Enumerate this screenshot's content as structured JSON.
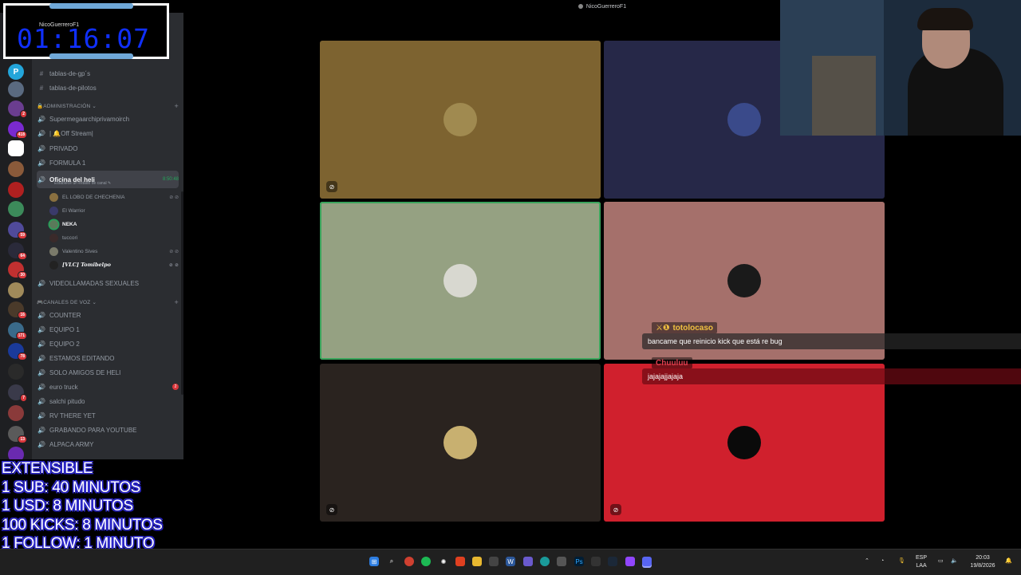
{
  "window_title": "NicoGuerreroF1",
  "timer": {
    "value": "01:16:07",
    "username": "NicoGuerreroF1"
  },
  "extensible": [
    "EXTENSIBLE",
    "1 SUB: 40 MINUTOS",
    "1 USD: 8 MINUTOS",
    "100 KICKS: 8 MINUTOS",
    "1 FOLLOW: 1 MINUTO"
  ],
  "channels_top": [
    {
      "name": "tablas-de-gp´s",
      "icon": "#"
    },
    {
      "name": "tablas-de-pilotos",
      "icon": "#"
    }
  ],
  "cat_admin": "🔒ADMINISTRACIÓN ⌄",
  "admin_channels": [
    {
      "name": "Supermegaarchiprivamoirch",
      "icon": "🔊"
    },
    {
      "name": "| 🔔Off Stream|",
      "icon": "🔊"
    },
    {
      "name": "PRIVADO",
      "icon": "🔊"
    },
    {
      "name": "FORMULA 1",
      "icon": "🔊"
    }
  ],
  "active_channel": {
    "name": "Oficina del heli",
    "time": "8:50:48",
    "status": "Establece un estado de canal ✎"
  },
  "members": [
    {
      "name": "EL LOBO DE CHECHENIA",
      "status": "⊘ ⊘",
      "style": ""
    },
    {
      "name": "El Warrior",
      "status": "",
      "style": ""
    },
    {
      "name": "NEKA",
      "status": "",
      "style": "bold"
    },
    {
      "name": "tuccori",
      "status": "",
      "style": ""
    },
    {
      "name": "Valentino Sives",
      "status": "⊘ ⊘",
      "style": ""
    },
    {
      "name": "[VLC] Tomibelpo",
      "status": "⊘ ⊘",
      "style": "italic"
    }
  ],
  "extra_channel": "VIDEOLLAMADAS SEXUALES",
  "cat_voz": "🎮CANALES DE VOZ ⌄",
  "voice_channels": [
    {
      "name": "COUNTER",
      "badge": ""
    },
    {
      "name": "EQUIPO 1",
      "badge": ""
    },
    {
      "name": "EQUIPO 2",
      "badge": ""
    },
    {
      "name": "ESTAMOS EDITANDO",
      "badge": ""
    },
    {
      "name": "SOLO AMIGOS DE HELI",
      "badge": ""
    },
    {
      "name": "euro truck",
      "badge": "2"
    },
    {
      "name": "salchi pitudo",
      "badge": ""
    },
    {
      "name": "RV THERE YET",
      "badge": ""
    },
    {
      "name": "GRABANDO PARA YOUTUBE",
      "badge": ""
    },
    {
      "name": "ALPACA ARMY",
      "badge": ""
    }
  ],
  "server_badges": [
    "2",
    "418",
    "59",
    "64",
    "30",
    "16",
    "171",
    "78",
    "7",
    "13"
  ],
  "chat": [
    {
      "name": "totolocaso",
      "prefix": "⚔❶",
      "message": "bancame que reinicio kick que está re bug",
      "color": "#f0c040"
    },
    {
      "name": "Chuuluu",
      "prefix": "",
      "message": "jajajajjajaja",
      "color": "#e0303a"
    }
  ],
  "tiles_colors": [
    "#7d6330",
    "#262848",
    "#95a182",
    "#a5706b",
    "#2a231f",
    "#d0202d"
  ],
  "taskbar": {
    "lang": "ESP",
    "layout": "LAA",
    "time": "20:03",
    "date": "19/8/2026"
  }
}
